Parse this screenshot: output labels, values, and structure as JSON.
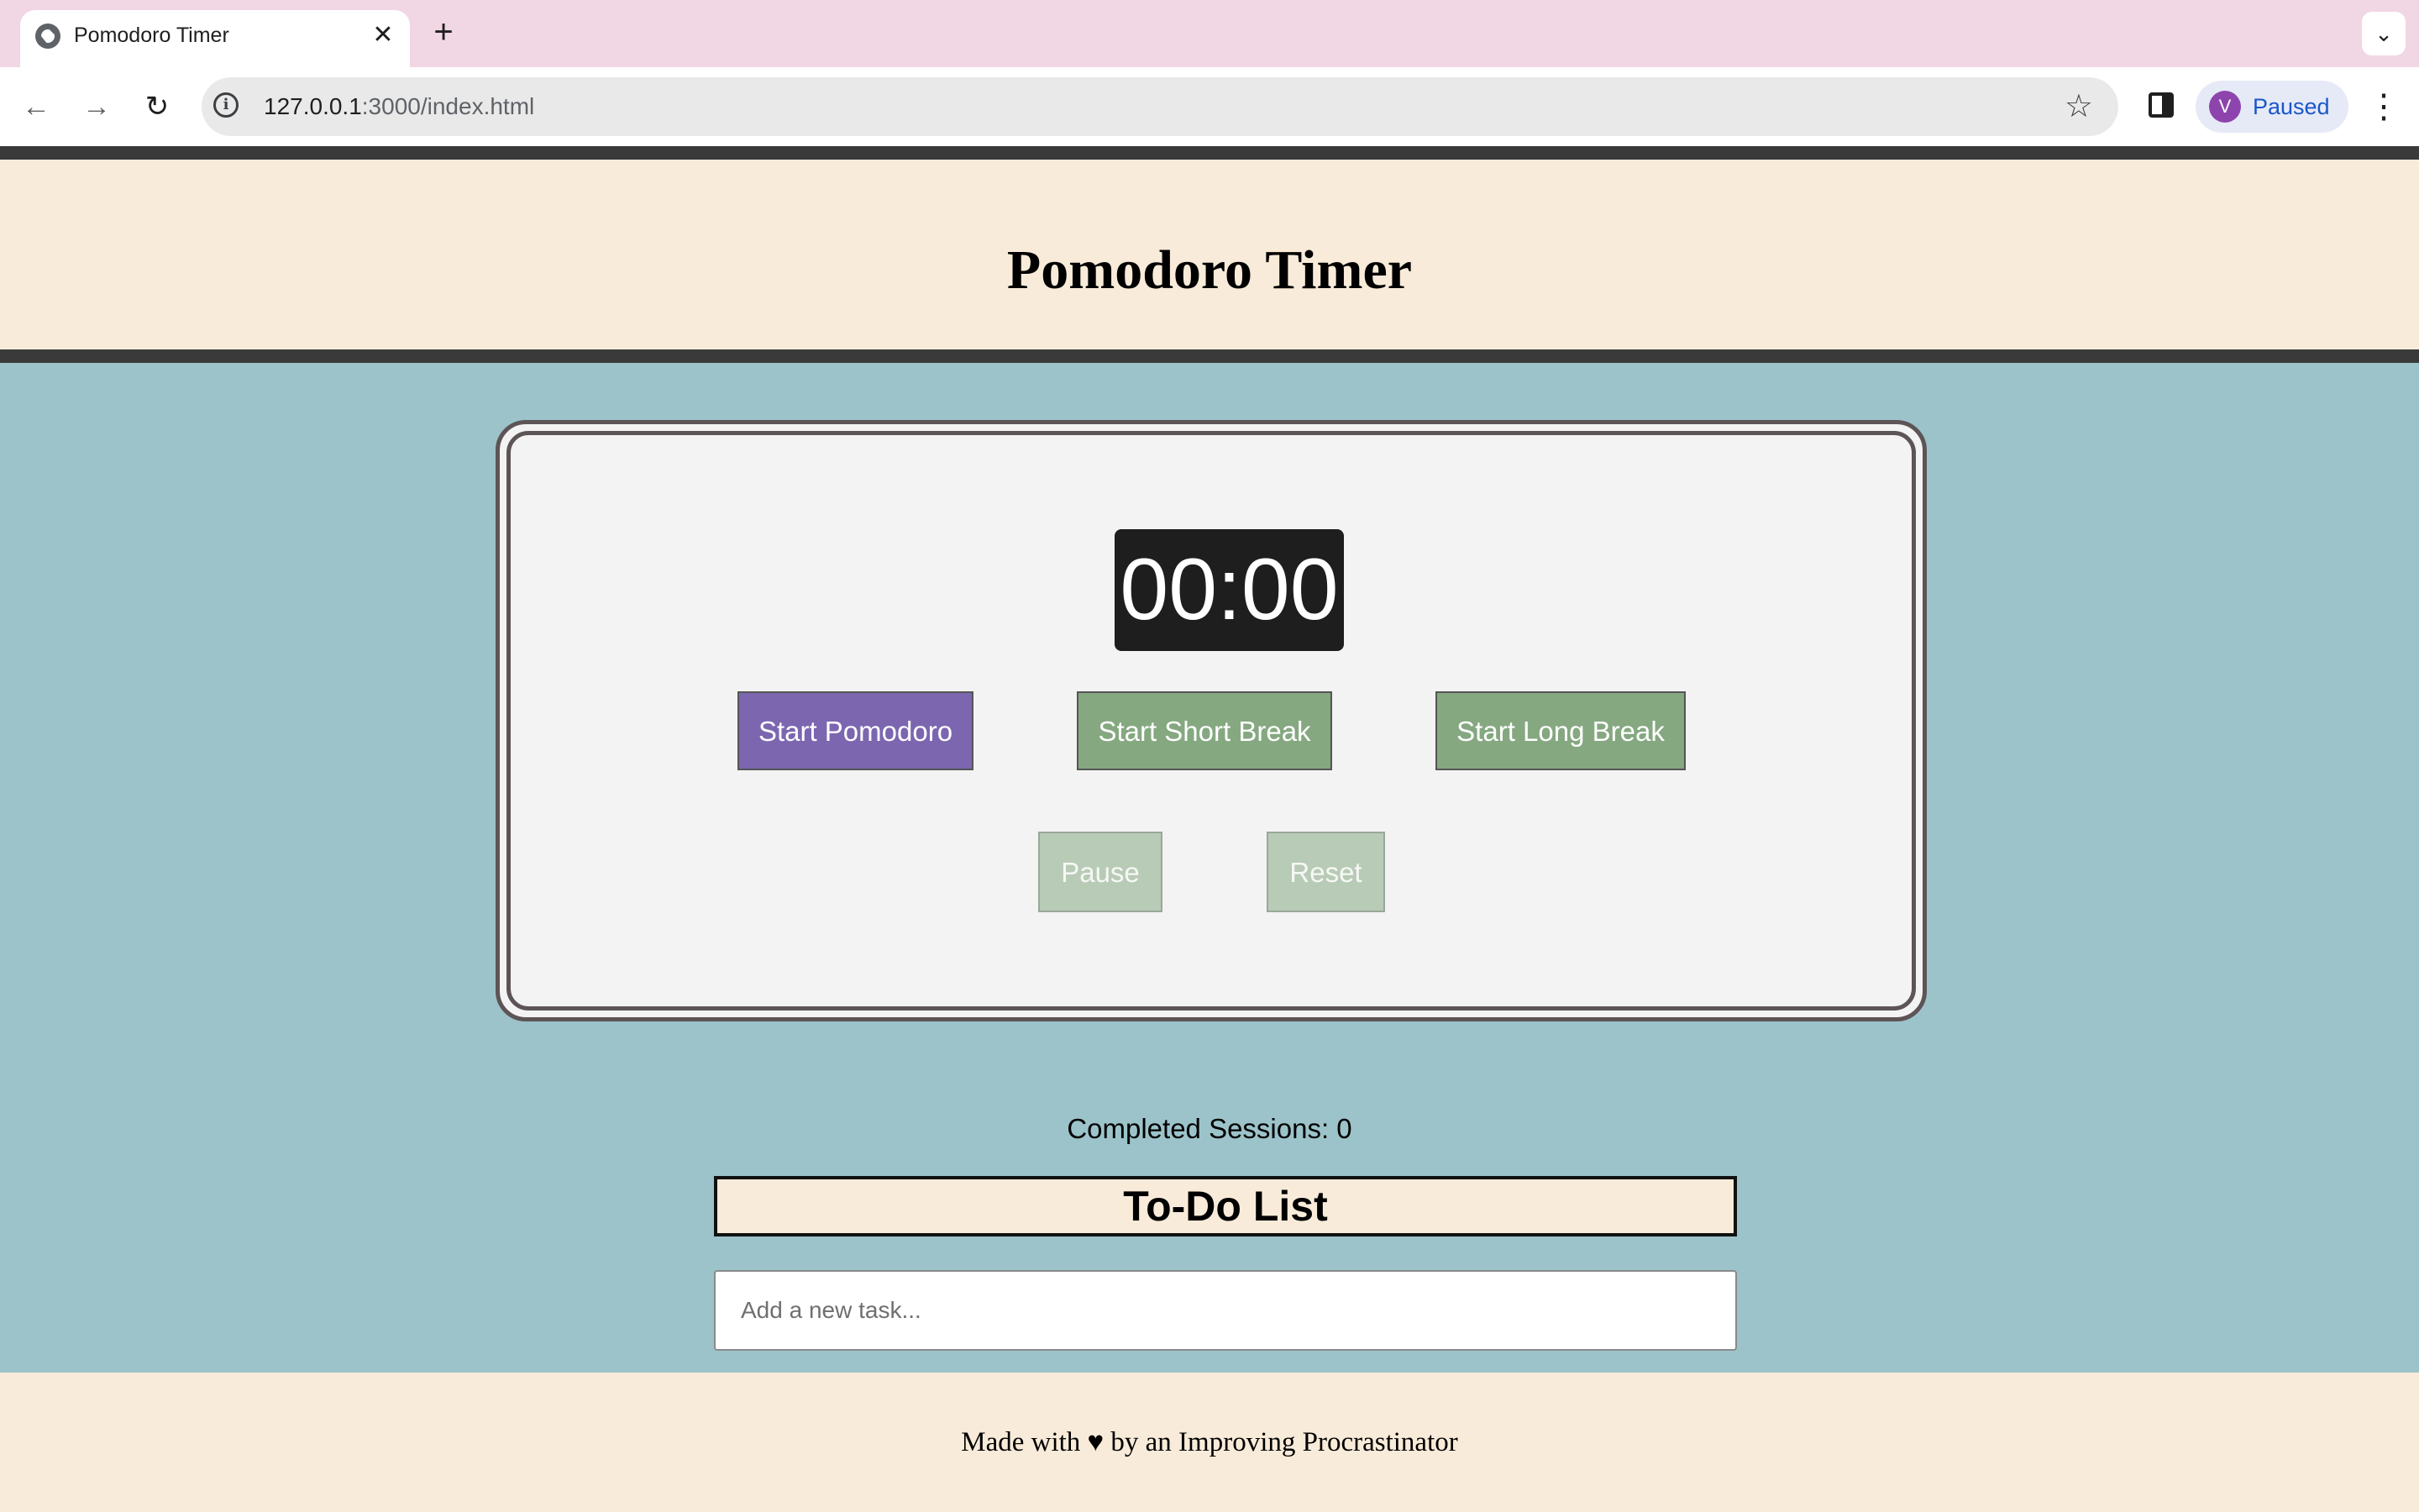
{
  "browser": {
    "tab_title": "Pomodoro Timer",
    "tab_close_glyph": "✕",
    "new_tab_glyph": "+",
    "tab_dropdown_glyph": "⌄",
    "url_host": "127.0.0.1",
    "url_path": ":3000/index.html",
    "profile_initial": "V",
    "profile_status": "Paused",
    "icons": [
      "globe-icon",
      "close-icon",
      "plus-icon",
      "chevron-down-icon",
      "back-arrow-icon",
      "forward-arrow-icon",
      "reload-icon",
      "info-icon",
      "star-icon",
      "side-panel-icon",
      "more-menu-icon"
    ]
  },
  "header": {
    "title": "Pomodoro Timer"
  },
  "timer": {
    "display": "00:00",
    "buttons": {
      "start_pomodoro": "Start Pomodoro",
      "start_short_break": "Start Short Break",
      "start_long_break": "Start Long Break",
      "pause": "Pause",
      "reset": "Reset"
    }
  },
  "sessions": {
    "text": "Completed Sessions: 0"
  },
  "todo": {
    "heading": "To-Do List",
    "placeholder": "Add a new task..."
  },
  "footer": {
    "text": "Made with ♥ by an Improving Procrastinator"
  },
  "colors": {
    "page_background": "#9cc3ca",
    "header_background": "#f8ebd9",
    "pomodoro_button": "#7c66b0",
    "break_button": "#85a881",
    "disabled_button": "#b8cbb6",
    "timer_background": "#1e1e1e"
  }
}
